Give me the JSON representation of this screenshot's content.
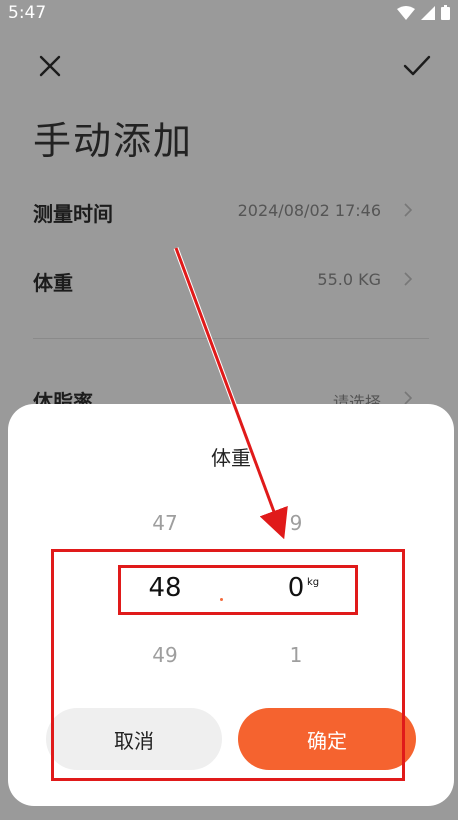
{
  "status_bar": {
    "time": "5:47"
  },
  "header": {
    "title": "手动添加"
  },
  "rows": [
    {
      "label": "测量时间",
      "value": "2024/08/02 17:46"
    },
    {
      "label": "体重",
      "value": "55.0 KG"
    },
    {
      "label": "体脂率",
      "value": "请选择"
    }
  ],
  "sheet": {
    "title": "体重",
    "integer_wheel": {
      "prev": "47",
      "selected": "48",
      "next": "49"
    },
    "decimal_wheel": {
      "prev": "9",
      "selected": "0",
      "next": "1"
    },
    "unit": "kg",
    "cancel_label": "取消",
    "confirm_label": "确定"
  },
  "colors": {
    "accent": "#f5632f",
    "annotation": "#e01a1a"
  }
}
